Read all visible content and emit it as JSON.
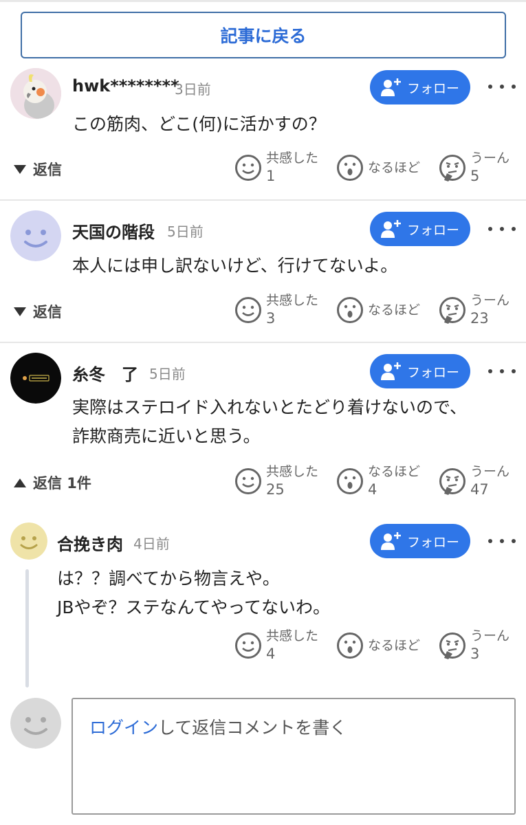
{
  "back_button": {
    "label": "記事に戻る"
  },
  "follow_label": "フォロー",
  "reactions_labels": {
    "empathy": "共感した",
    "naruhodo": "なるほど",
    "uun": "うーん"
  },
  "comments": [
    {
      "user": "hwk********",
      "time": "3日前",
      "text_lines": [
        "この筋肉、どこ(何)に活かすの？"
      ],
      "reply_label": "返信",
      "reactions": {
        "empathy": "1",
        "naruhodo": "",
        "uun": "5"
      }
    },
    {
      "user": "天国の階段",
      "time": "5日前",
      "text_lines": [
        "本人には申し訳ないけど、行けてないよ。"
      ],
      "reply_label": "返信",
      "reactions": {
        "empathy": "3",
        "naruhodo": "",
        "uun": "23"
      }
    },
    {
      "user": "糸冬　了",
      "time": "5日前",
      "text_lines": [
        "実際はステロイド入れないとたどり着けないので、",
        "詐欺商売に近いと思う。"
      ],
      "reply_label": "返信 1件",
      "reactions": {
        "empathy": "25",
        "naruhodo": "4",
        "uun": "47"
      }
    }
  ],
  "reply": {
    "user": "合挽き肉",
    "time": "4日前",
    "text_lines": [
      "は？？調べてから物言えや。",
      "JBやぞ？ステなんてやってないわ。"
    ],
    "reactions": {
      "empathy": "4",
      "naruhodo": "",
      "uun": "3"
    }
  },
  "login_prompt": {
    "link": "ログイン",
    "rest": "して返信コメントを書く"
  },
  "colors": {
    "accent": "#2f76e8",
    "link": "#2c6bd6"
  }
}
